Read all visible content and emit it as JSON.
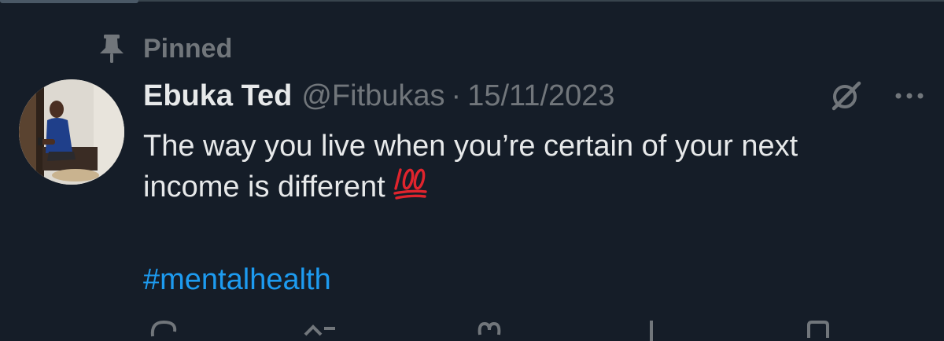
{
  "pinned": {
    "label": "Pinned",
    "icon": "pin-icon"
  },
  "tweet": {
    "author": {
      "display_name": "Ebuka Ted",
      "handle": "@Fitbukas",
      "avatar": "avatar"
    },
    "separator": "·",
    "date": "15/11/2023",
    "text_line1": "The way you live when you’re certain of your next",
    "text_line2": "income is different",
    "emoji": "💯",
    "hashtag": "#mentalhealth",
    "header_icons": [
      "grok-icon",
      "more-icon"
    ],
    "actions": [
      "reply-icon",
      "retweet-icon",
      "like-icon",
      "views-icon",
      "bookmark-icon"
    ]
  },
  "colors": {
    "background": "#151d28",
    "text_primary": "#e7e9ea",
    "text_secondary": "#71767b",
    "link": "#1d9bf0",
    "emoji_red": "#e0242d"
  }
}
